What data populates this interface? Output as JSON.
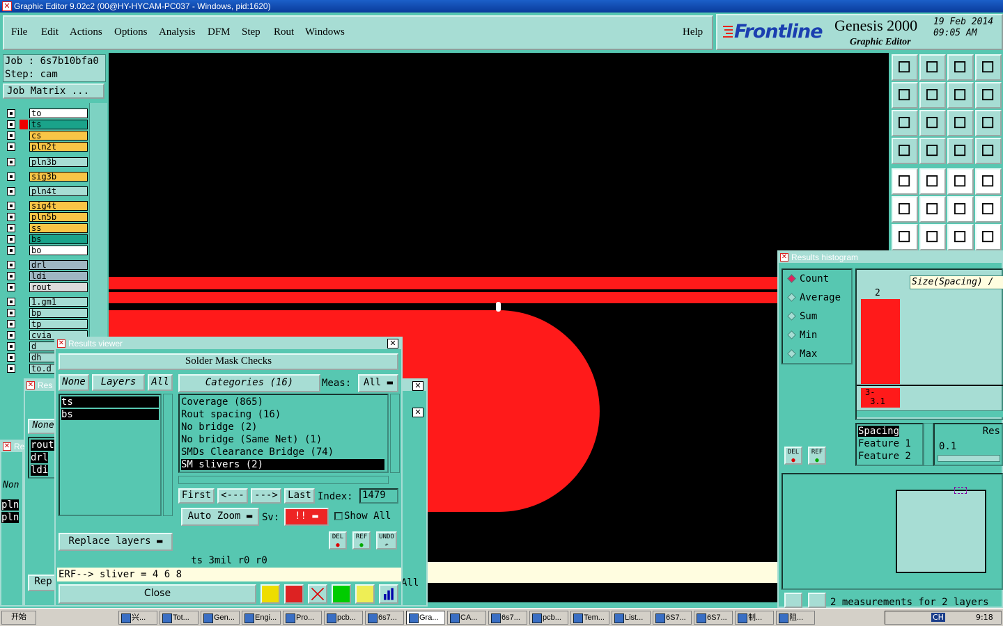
{
  "window": {
    "title": "Graphic Editor 9.02c2 (00@HY-HYCAM-PC037 - Windows, pid:1620)"
  },
  "menu": {
    "items": [
      "File",
      "Edit",
      "Actions",
      "Options",
      "Analysis",
      "DFM",
      "Step",
      "Rout",
      "Windows"
    ],
    "help": "Help"
  },
  "brand": {
    "logo": "Frontline",
    "product": "Genesis 2000",
    "subtitle": "Graphic Editor",
    "date": "19 Feb 2014",
    "time": "09:05 AM"
  },
  "job": {
    "job_line": "Job  : 6s7b10bfa0",
    "step_line": "Step: cam",
    "matrix_button": "Job Matrix ..."
  },
  "layers": [
    {
      "name": "to",
      "color": "#ffffff"
    },
    {
      "name": "ts",
      "color": "#1aa38a"
    },
    {
      "name": "cs",
      "color": "#f9c546"
    },
    {
      "name": "pln2t",
      "color": "#f9c546"
    },
    {
      "name": "pln3b",
      "color": "#a7ddd4"
    },
    {
      "name": "sig3b",
      "color": "#f9c546"
    },
    {
      "name": "pln4t",
      "color": "#a7ddd4"
    },
    {
      "name": "sig4t",
      "color": "#f9c546"
    },
    {
      "name": "pln5b",
      "color": "#f9c546"
    },
    {
      "name": "ss",
      "color": "#f9c546"
    },
    {
      "name": "bs",
      "color": "#1aa38a"
    },
    {
      "name": "bo",
      "color": "#ffffff"
    },
    {
      "name": "drl",
      "color": "#9fb6c2"
    },
    {
      "name": "ldi",
      "color": "#9fb6c2"
    },
    {
      "name": "rout",
      "color": "#dcdcdc"
    },
    {
      "name": "1.gm1",
      "color": "#a7ddd4"
    },
    {
      "name": "bp",
      "color": "#a7ddd4"
    },
    {
      "name": "tp",
      "color": "#a7ddd4"
    },
    {
      "name": "cvia",
      "color": "#a7ddd4"
    },
    {
      "name": "d",
      "color": "#a7ddd4"
    },
    {
      "name": "dh",
      "color": "#a7ddd4"
    },
    {
      "name": "to.d",
      "color": "#a7ddd4"
    }
  ],
  "results_viewer": {
    "title": "Results viewer",
    "section": "Solder Mask Checks",
    "none_btn": "None",
    "layers_btn": "Layers",
    "all_btn": "All",
    "layer_list": [
      "ts",
      "bs"
    ],
    "categories_btn": "Categories (16)",
    "meas_label": "Meas:",
    "meas_value": "All",
    "categories": [
      "Coverage (865)",
      "Rout spacing (16)",
      "No bridge (2)",
      "No bridge (Same Net) (1)",
      "SMDs Clearance Bridge (74)",
      "SM slivers (2)"
    ],
    "nav": {
      "first": "First",
      "prev": "<---",
      "next": "--->",
      "last": "Last",
      "index_label": "Index:",
      "index_value": "1479"
    },
    "auto_zoom": "Auto Zoom",
    "sv_label": "Sv:",
    "sv_value": "!!",
    "show_all": "Show All",
    "replace_layers": "Replace layers",
    "icon_labels": {
      "del": "DEL",
      "ref": "REF",
      "undo": "UNDO"
    },
    "status_line": "ts 3mil   r0   r0",
    "erf_line": "ERF--> sliver = 4 6 8",
    "close": "Close"
  },
  "back_windows": {
    "res1_title": "Res",
    "res2_title": "Re",
    "none_text": "None",
    "non_text": "Non",
    "list_items": [
      "rout",
      "drl",
      "ldi"
    ],
    "pln_items": [
      "pln",
      "pln"
    ],
    "rep": "Rep",
    "all_text": "All"
  },
  "histogram": {
    "title": "Results histogram",
    "modes": [
      "Count",
      "Average",
      "Sum",
      "Min",
      "Max"
    ],
    "selected_mode": "Count",
    "size_label": "Size(Spacing) /",
    "bar_count": "2",
    "bar_label": "3-\n 3.1",
    "columns": [
      "Spacing",
      "Feature 1",
      "Feature 2"
    ],
    "res_label": "Res",
    "res_value": "0.1",
    "del": "DEL",
    "ref": "REF",
    "footer": "2 measurements for 2 layers"
  },
  "chart_data": {
    "type": "bar",
    "categories": [
      "3-3.1"
    ],
    "values": [
      2
    ],
    "title": "Size(Spacing)"
  },
  "taskbar": {
    "start": "开始",
    "items": [
      "兴...",
      "Tot...",
      "Gen...",
      "Engi...",
      "Pro...",
      "pcb...",
      "6s7...",
      "Gra...",
      "CA...",
      "6s7...",
      "pcb...",
      "Tem...",
      "List...",
      "6S7...",
      "6S7...",
      "制...",
      "阻..."
    ],
    "clock": "9:18",
    "lang": "CH"
  },
  "colors": {
    "panel": "#57c7b1",
    "panel_light": "#a7ddd4",
    "feature": "#ff1a1a",
    "canvas": "#000000"
  }
}
